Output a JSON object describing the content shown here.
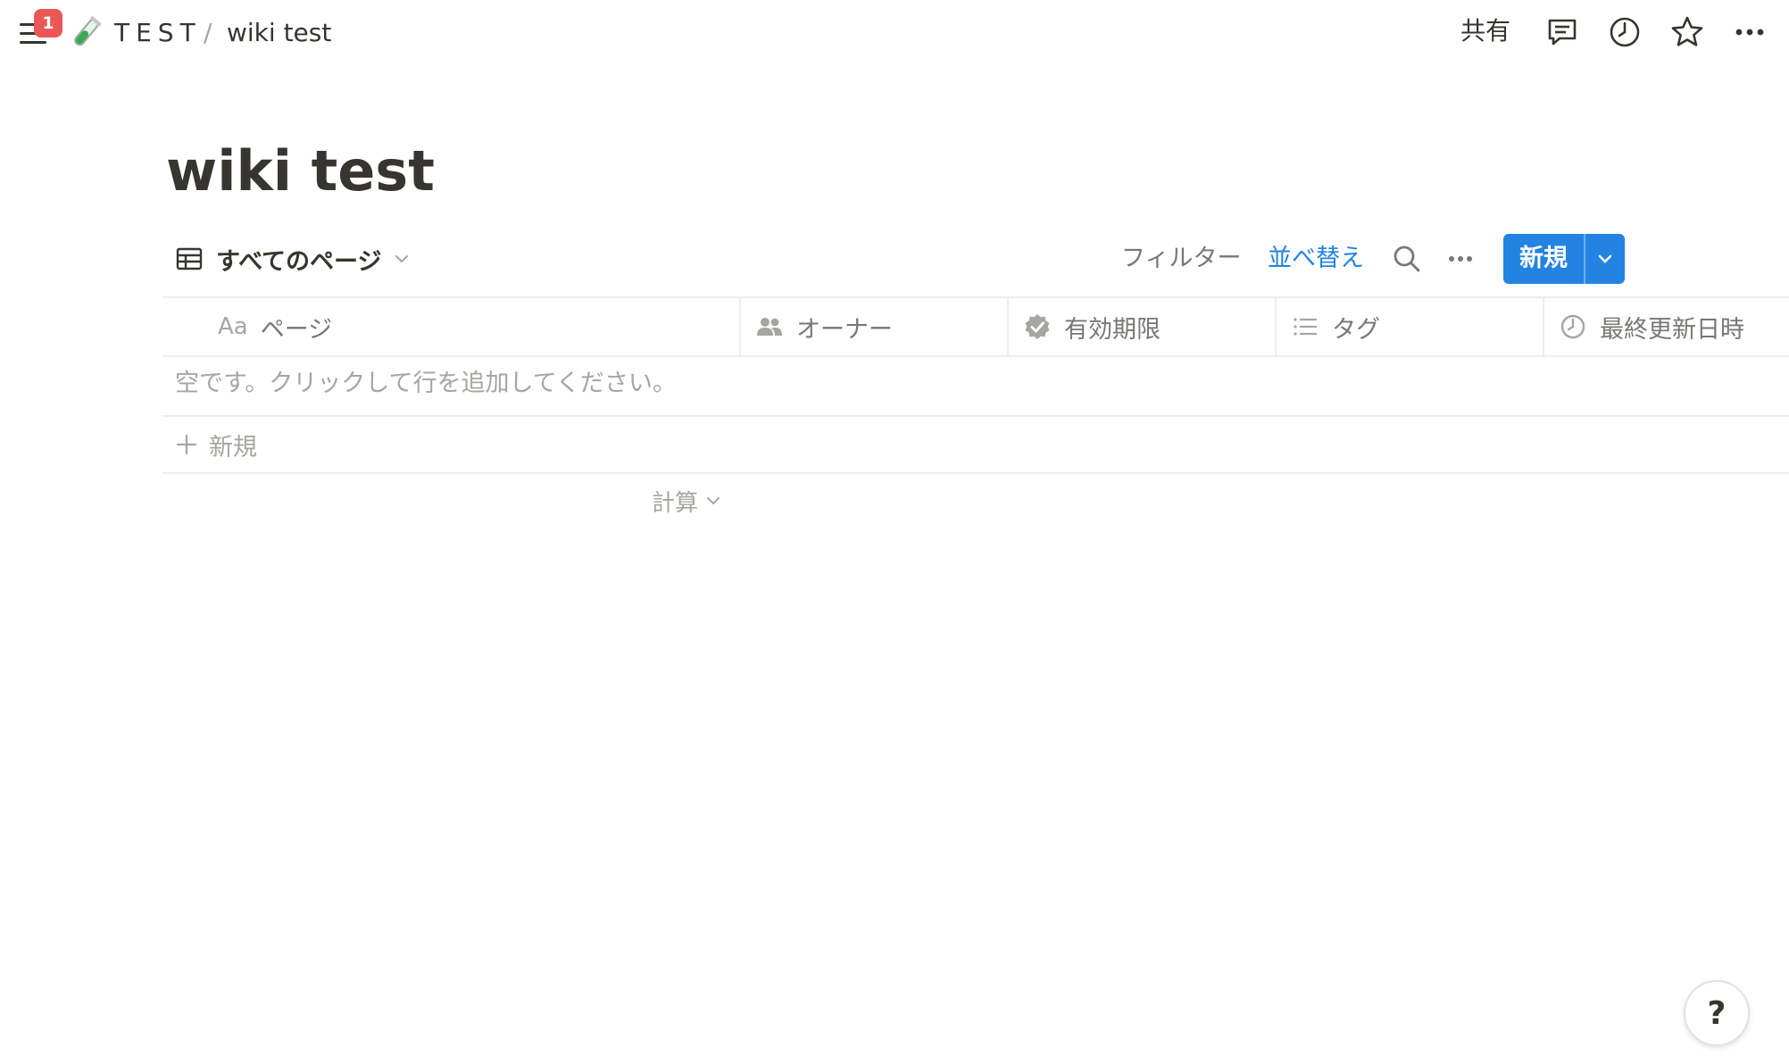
{
  "topbar": {
    "notification_count": "1",
    "workspace_name": "TEST",
    "separator": "/",
    "page_name": "wiki test",
    "share_label": "共有"
  },
  "page": {
    "title": "wiki test"
  },
  "view": {
    "tab_label": "すべてのページ",
    "filter_label": "フィルター",
    "sort_label": "並べ替え",
    "new_label": "新規",
    "sort_color": "#2383e2",
    "accent_color": "#2383e2"
  },
  "table": {
    "columns": [
      {
        "icon": "text-aa-icon",
        "prefix": "Aa",
        "label": "ページ"
      },
      {
        "icon": "people-icon",
        "label": "オーナー"
      },
      {
        "icon": "verified-badge-icon",
        "label": "有効期限"
      },
      {
        "icon": "list-icon",
        "label": "タグ"
      },
      {
        "icon": "clock-icon",
        "label": "最終更新日時"
      }
    ],
    "empty_text": "空です。クリックして行を追加してください。",
    "add_row_label": "新規",
    "calculate_label": "計算"
  },
  "help": {
    "label": "?"
  }
}
